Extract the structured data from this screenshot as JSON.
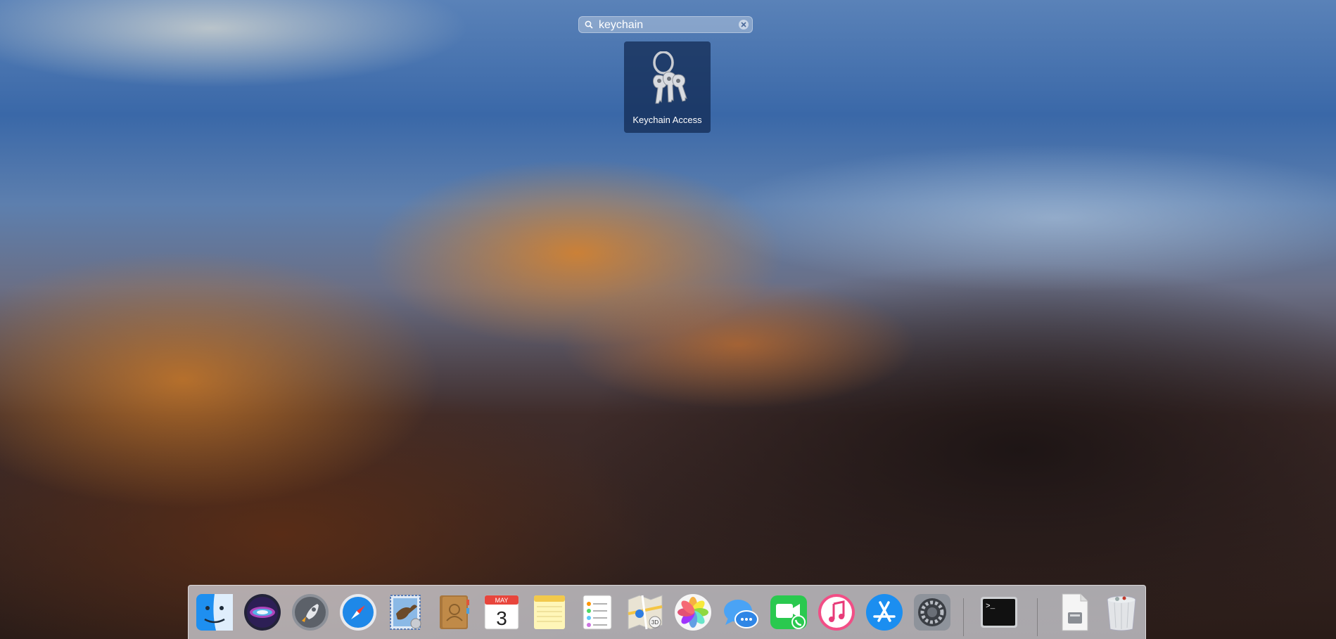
{
  "launchpad": {
    "search": {
      "value": "keychain",
      "placeholder": "Search"
    },
    "results": [
      {
        "label": "Keychain Access",
        "icon": "keychain-access-icon"
      }
    ]
  },
  "dock": {
    "apps": [
      {
        "name": "Finder",
        "icon": "finder-icon"
      },
      {
        "name": "Siri",
        "icon": "siri-icon"
      },
      {
        "name": "Launchpad",
        "icon": "launchpad-icon"
      },
      {
        "name": "Safari",
        "icon": "safari-icon"
      },
      {
        "name": "Mail",
        "icon": "mail-icon"
      },
      {
        "name": "Contacts",
        "icon": "contacts-icon"
      },
      {
        "name": "Calendar",
        "icon": "calendar-icon"
      },
      {
        "name": "Notes",
        "icon": "notes-icon"
      },
      {
        "name": "Reminders",
        "icon": "reminders-icon"
      },
      {
        "name": "Maps",
        "icon": "maps-icon"
      },
      {
        "name": "Photos",
        "icon": "photos-icon"
      },
      {
        "name": "Messages",
        "icon": "messages-icon"
      },
      {
        "name": "FaceTime",
        "icon": "facetime-icon"
      },
      {
        "name": "iTunes",
        "icon": "itunes-icon"
      },
      {
        "name": "App Store",
        "icon": "app-store-icon"
      },
      {
        "name": "System Preferences",
        "icon": "system-preferences-icon"
      },
      {
        "name": "Terminal",
        "icon": "terminal-icon"
      },
      {
        "name": "Document",
        "icon": "document-icon"
      },
      {
        "name": "Trash",
        "icon": "trash-icon"
      }
    ],
    "calendar": {
      "month": "MAY",
      "day": "3"
    },
    "terminal": {
      "prompt": ">_"
    },
    "maps": {
      "badge": "3D"
    }
  },
  "colors": {
    "tile_bg": "#10284f",
    "dock_bg": "#dcdee4"
  }
}
